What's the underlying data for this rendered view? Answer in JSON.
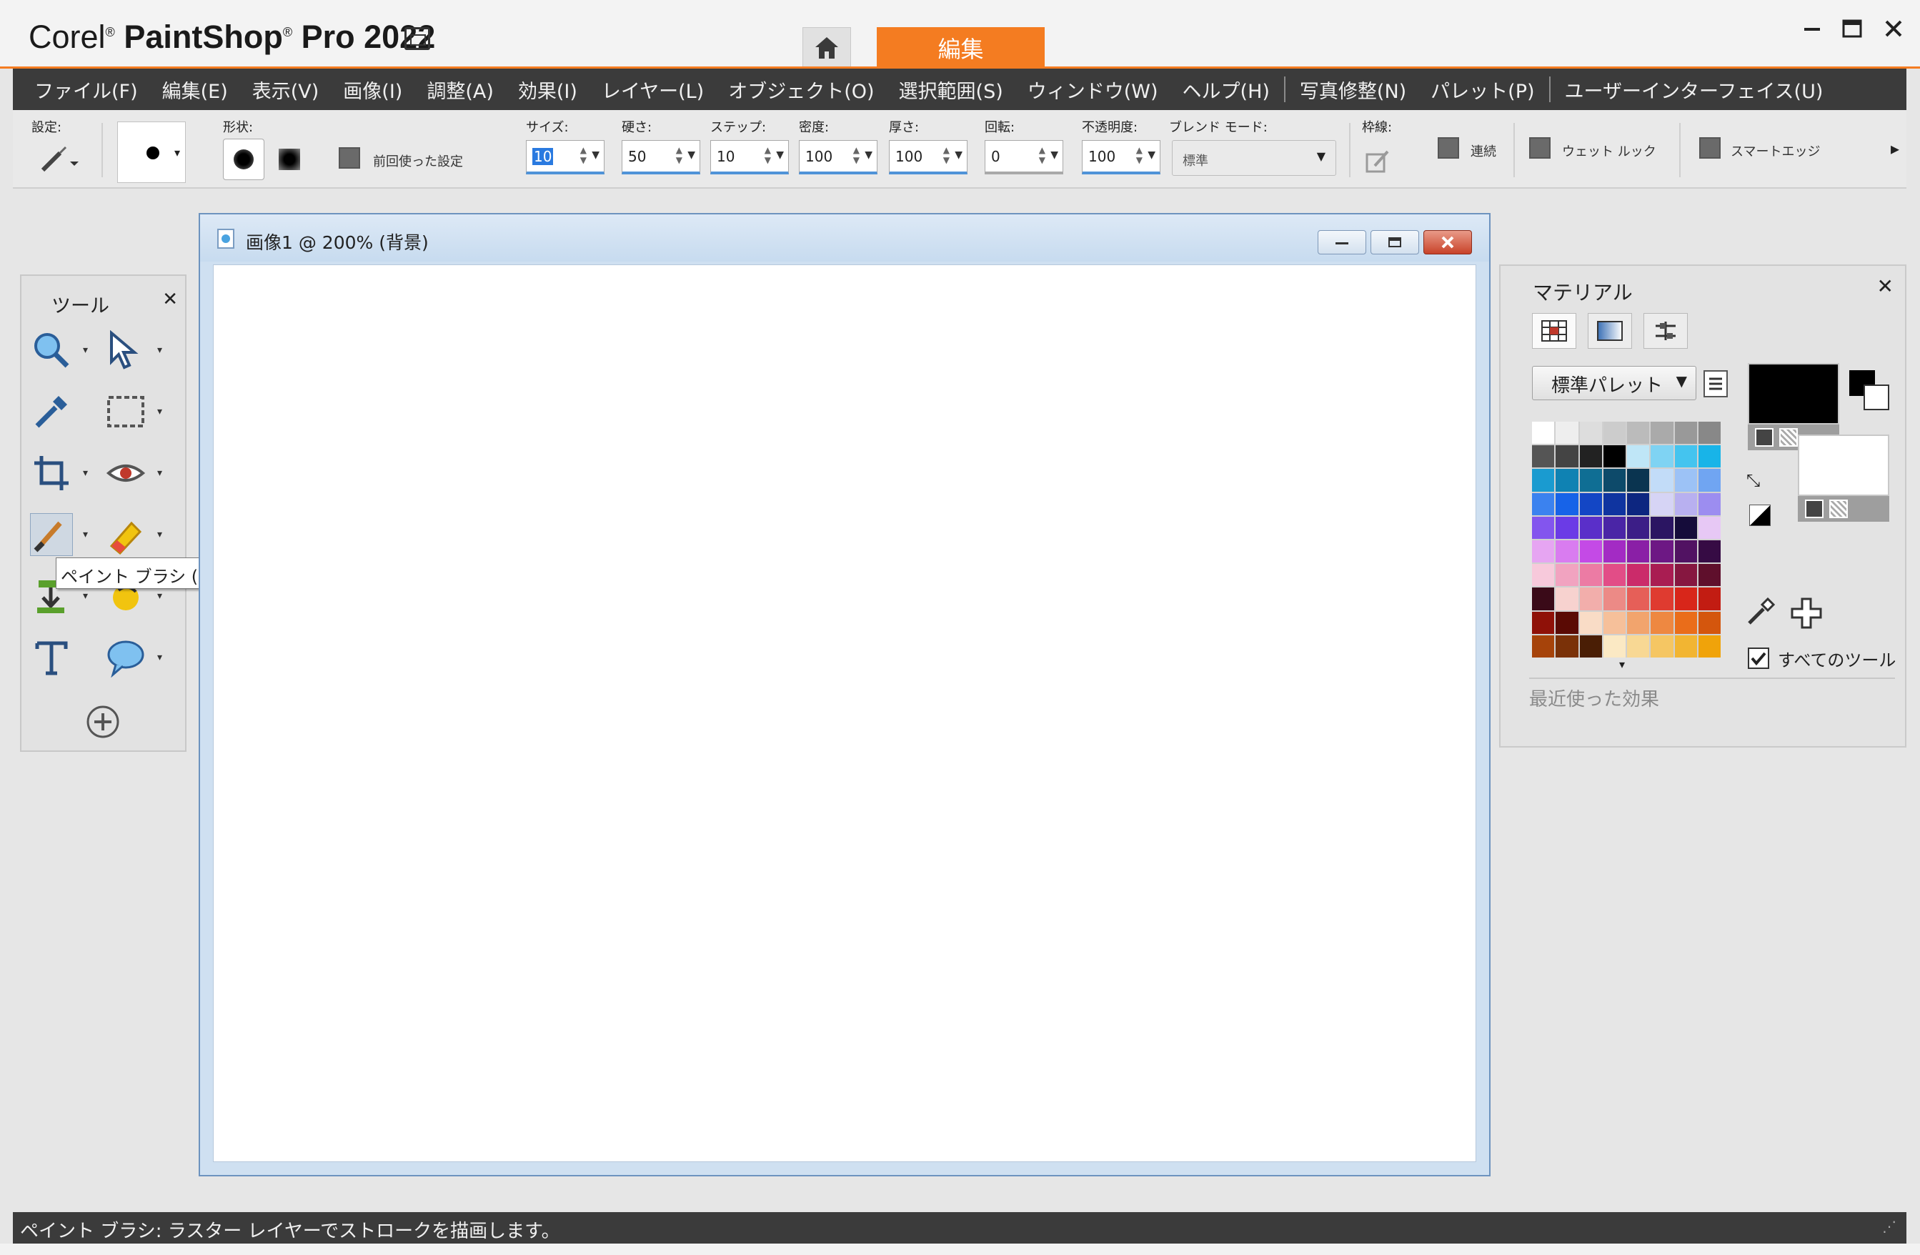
{
  "titlebar": {
    "brand": "Corel",
    "product": "PaintShop",
    "edition": "Pro 2022",
    "edit_tab": "編集"
  },
  "menu": {
    "items": [
      "ファイル(F)",
      "編集(E)",
      "表示(V)",
      "画像(I)",
      "調整(A)",
      "効果(I)",
      "レイヤー(L)",
      "オブジェクト(O)",
      "選択範囲(S)",
      "ウィンドウ(W)",
      "ヘルプ(H)"
    ],
    "extra": [
      "写真修整(N)",
      "パレット(P)",
      "ユーザーインターフェイス(U)"
    ]
  },
  "options": {
    "preset_label": "設定:",
    "shape_label": "形状:",
    "last_used_label": "前回使った設定",
    "size_label": "サイズ:",
    "size_value": "10",
    "hardness_label": "硬さ:",
    "hardness_value": "50",
    "step_label": "ステップ:",
    "step_value": "10",
    "density_label": "密度:",
    "density_value": "100",
    "thickness_label": "厚さ:",
    "thickness_value": "100",
    "rotation_label": "回転:",
    "rotation_value": "0",
    "opacity_label": "不透明度:",
    "opacity_value": "100",
    "blend_label": "ブレンド モード:",
    "blend_value": "標準",
    "stroke_label": "枠線:",
    "continuous_label": "連続",
    "wet_look_label": "ウェット ルック",
    "smart_edge_label": "スマートエッジ"
  },
  "tools": {
    "title": "ツール",
    "tooltip": "ペイント ブラシ (B)"
  },
  "image_window": {
    "title": "画像1 @ 200% (背景)"
  },
  "materials": {
    "title": "マテリアル",
    "palette_name": "標準パレット",
    "all_tools_label": "すべてのツール",
    "recent_effects_label": "最近使った効果",
    "foreground_color": "#000000",
    "background_color": "#ffffff",
    "swatches": [
      "#ffffff",
      "#eeeeee",
      "#dddddd",
      "#cccccc",
      "#bbbbbb",
      "#aaaaaa",
      "#999999",
      "#888888",
      "#555555",
      "#444444",
      "#222222",
      "#000000",
      "#bfe6f7",
      "#7fd3f3",
      "#44c4ef",
      "#18b4e8",
      "#1a9bd0",
      "#0f82b3",
      "#0f6e94",
      "#0d4a6a",
      "#0a3450",
      "#c2dcf8",
      "#9cc2f6",
      "#70a5f2",
      "#3b82ef",
      "#1763e8",
      "#1346c5",
      "#0f34a0",
      "#0d2680",
      "#d6d4f5",
      "#b8b0f0",
      "#9c8df0",
      "#8355ee",
      "#6b3be6",
      "#5a2fc9",
      "#4a25a6",
      "#3c1e87",
      "#2b1562",
      "#150c3a",
      "#e7c8f5",
      "#e6a5f2",
      "#d97cf0",
      "#c44ae6",
      "#a32bc4",
      "#8a1fa6",
      "#6d1884",
      "#511262",
      "#360b44",
      "#f7c9db",
      "#f1a3c0",
      "#ec7ba4",
      "#e24d87",
      "#cb2b6a",
      "#a91d52",
      "#861740",
      "#5f0f2c",
      "#3a0a18",
      "#f7d2cf",
      "#f2aeab",
      "#ec8a86",
      "#e65f58",
      "#df3b30",
      "#d8261a",
      "#c21c12",
      "#8f1108",
      "#5a0a04",
      "#f9dcc6",
      "#f6c09a",
      "#f2a46d",
      "#ee8841",
      "#ea6d1a",
      "#d4560d",
      "#a6430a",
      "#7a3108",
      "#4a1e05",
      "#fbe9c4",
      "#f8d894",
      "#f5c663",
      "#f2b532",
      "#f0a30a"
    ]
  },
  "status": {
    "text": "ペイント ブラシ: ラスター レイヤーでストロークを描画します。"
  }
}
